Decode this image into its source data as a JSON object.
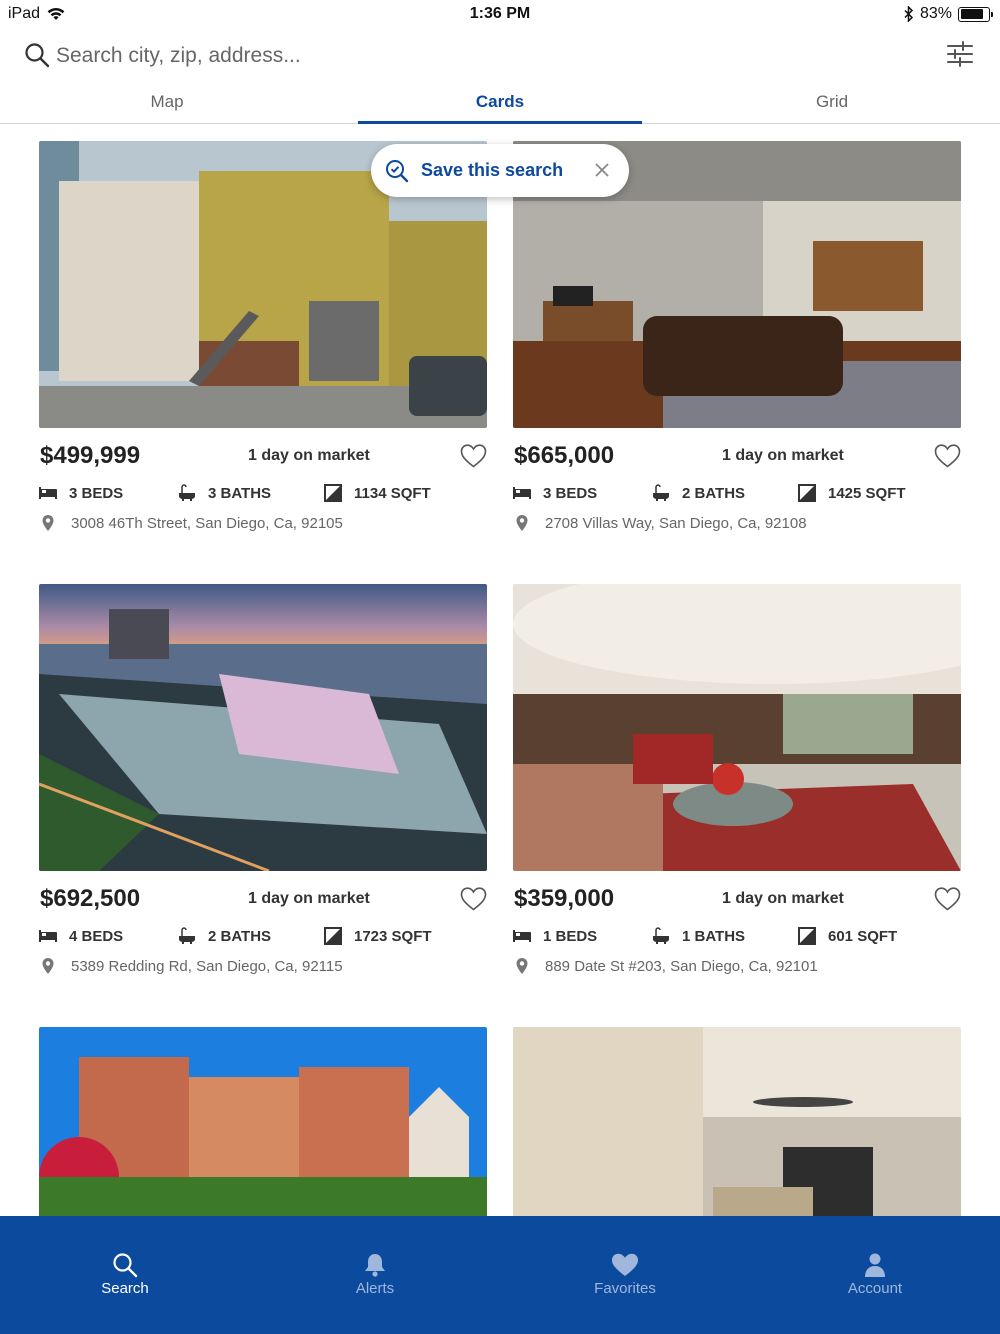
{
  "status": {
    "device": "iPad",
    "time": "1:36 PM",
    "battery": "83%",
    "battery_level": 0.83
  },
  "search": {
    "placeholder": "Search city, zip, address..."
  },
  "tabs": [
    {
      "label": "Map",
      "active": false
    },
    {
      "label": "Cards",
      "active": true
    },
    {
      "label": "Grid",
      "active": false
    }
  ],
  "save_search": {
    "label": "Save this search"
  },
  "listings": [
    {
      "price": "$499,999",
      "days_on_market": "1 day on market",
      "beds": "3 BEDS",
      "baths": "3 BATHS",
      "sqft": "1134 SQFT",
      "address": "3008 46Th Street, San Diego, Ca, 92105"
    },
    {
      "price": "$665,000",
      "days_on_market": "1 day on market",
      "beds": "3 BEDS",
      "baths": "2 BATHS",
      "sqft": "1425 SQFT",
      "address": "2708 Villas Way, San Diego, Ca, 92108"
    },
    {
      "price": "$692,500",
      "days_on_market": "1 day on market",
      "beds": "4 BEDS",
      "baths": "2 BATHS",
      "sqft": "1723 SQFT",
      "address": "5389 Redding Rd, San Diego, Ca, 92115"
    },
    {
      "price": "$359,000",
      "days_on_market": "1 day on market",
      "beds": "1 BEDS",
      "baths": "1 BATHS",
      "sqft": "601 SQFT",
      "address": "889 Date St #203, San Diego, Ca, 92101"
    }
  ],
  "bottom_nav": [
    {
      "label": "Search",
      "icon": "search-icon",
      "active": true
    },
    {
      "label": "Alerts",
      "icon": "bell-icon",
      "active": false
    },
    {
      "label": "Favorites",
      "icon": "heart-icon",
      "active": false
    },
    {
      "label": "Account",
      "icon": "person-icon",
      "active": false
    }
  ],
  "colors": {
    "brand": "#0d4a9e",
    "nav_bg": "#0b4a9c"
  }
}
